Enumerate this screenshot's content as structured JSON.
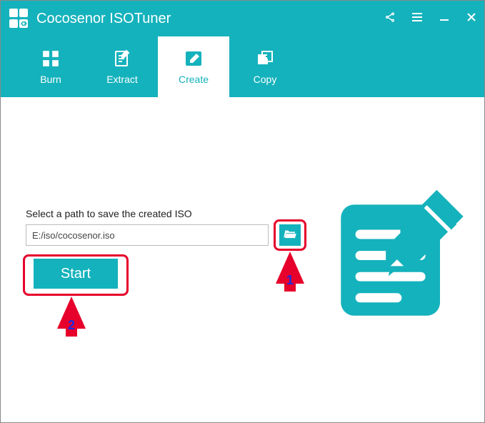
{
  "header": {
    "title": "Cocosenor ISOTuner"
  },
  "tabs": [
    {
      "label": "Burn",
      "active": false
    },
    {
      "label": "Extract",
      "active": false
    },
    {
      "label": "Create",
      "active": true
    },
    {
      "label": "Copy",
      "active": false
    }
  ],
  "main": {
    "path_label": "Select a path to save the created ISO",
    "path_value": "E:/iso/cocosenor.iso",
    "start_label": "Start"
  },
  "annotations": {
    "step1": "1",
    "step2": "2"
  }
}
